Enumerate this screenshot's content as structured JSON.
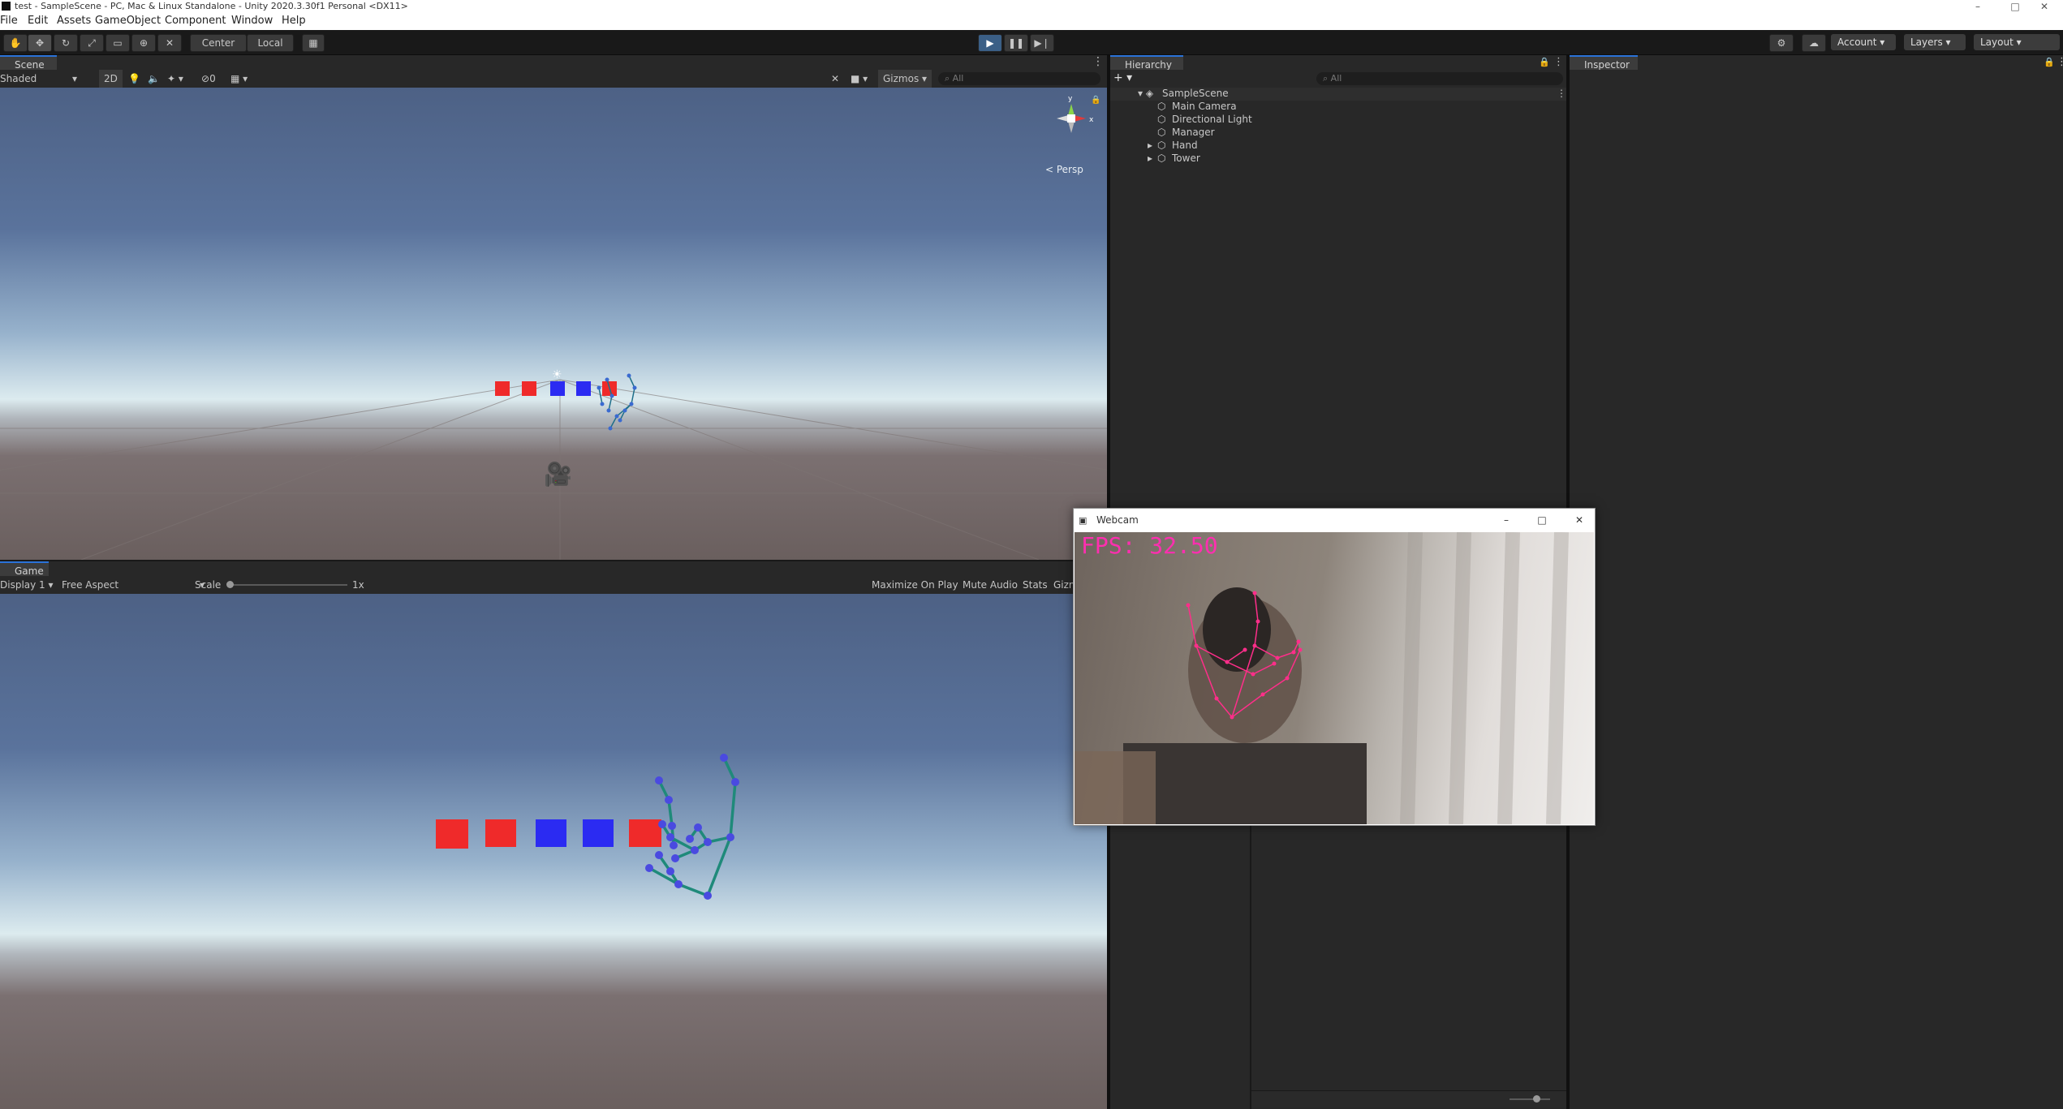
{
  "window": {
    "title": "test - SampleScene - PC, Mac & Linux Standalone - Unity 2020.3.30f1 Personal <DX11>",
    "controls": [
      "–",
      "□",
      "✕"
    ]
  },
  "menu": [
    "File",
    "Edit",
    "Assets",
    "GameObject",
    "Component",
    "Window",
    "Help"
  ],
  "toolbar": {
    "tools": [
      "hand-tool",
      "move-tool",
      "rotate-tool",
      "scale-tool",
      "rect-tool",
      "transform-tool",
      "custom-tool"
    ],
    "pivot": "Center",
    "space": "Local",
    "account": "Account",
    "layers": "Layers",
    "layout": "Layout"
  },
  "scene": {
    "tab": "Scene",
    "draw_mode": "Shaded",
    "mode_2d": "2D",
    "hidden_count": "0",
    "gizmos": "Gizmos",
    "search_placeholder": "All",
    "gizmo_axis_y": "y",
    "gizmo_axis_x": "x",
    "projection": "< Persp"
  },
  "game": {
    "tab": "Game",
    "display": "Display 1",
    "aspect": "Free Aspect",
    "scale_label": "Scale",
    "scale_value": "1x",
    "maximize": "Maximize On Play",
    "mute": "Mute Audio",
    "stats": "Stats",
    "gizmos": "Gizmos"
  },
  "hierarchy": {
    "tab": "Hierarchy",
    "add": "+",
    "search_placeholder": "All",
    "scene_name": "SampleScene",
    "items": [
      {
        "label": "Main Camera",
        "expandable": false
      },
      {
        "label": "Directional Light",
        "expandable": false
      },
      {
        "label": "Manager",
        "expandable": false
      },
      {
        "label": "Hand",
        "expandable": true
      },
      {
        "label": "Tower",
        "expandable": true
      }
    ]
  },
  "inspector": {
    "tab": "Inspector"
  },
  "webcam": {
    "title": "Webcam",
    "fps_text": "FPS: 32.50"
  },
  "colors": {
    "red_cube": "#ef2a2a",
    "blue_cube": "#2b2bf2",
    "hand_line": "#1f8a7a",
    "hand_joint": "#4a4ae0",
    "landmark": "#ff2e8a",
    "accent": "#2a72d8"
  }
}
